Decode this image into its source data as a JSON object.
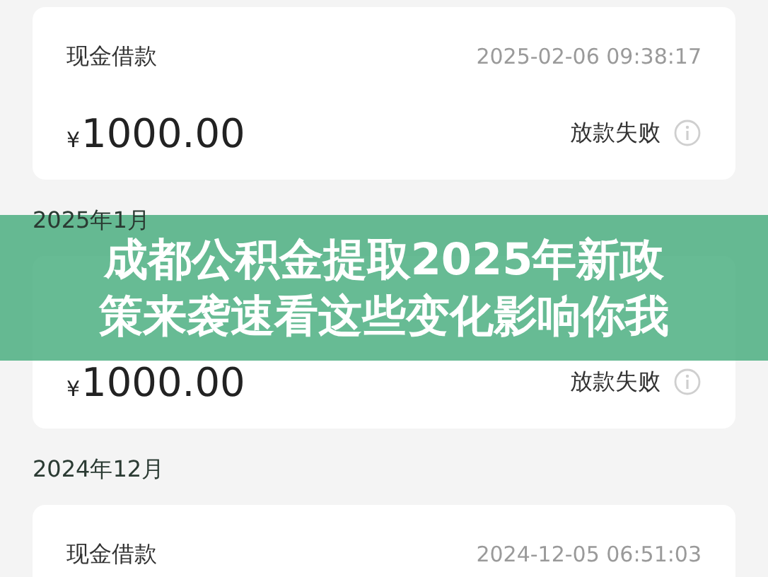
{
  "list": [
    {
      "kind": "card",
      "title": "现金借款",
      "time": "2025-02-06 09:38:17",
      "currency": "¥",
      "amount": "1000.00",
      "status": "放款失败"
    },
    {
      "kind": "header",
      "label": "2025年1月"
    },
    {
      "kind": "card",
      "currency": "¥",
      "amount": "1000.00",
      "status": "放款失败"
    },
    {
      "kind": "header",
      "label": "2024年12月"
    },
    {
      "kind": "card",
      "title": "现金借款",
      "time": "2024-12-05 06:51:03"
    }
  ],
  "banner": {
    "lines": [
      "成都公积金提取2025年新政",
      "策来袭速看这些变化影响你我"
    ]
  }
}
